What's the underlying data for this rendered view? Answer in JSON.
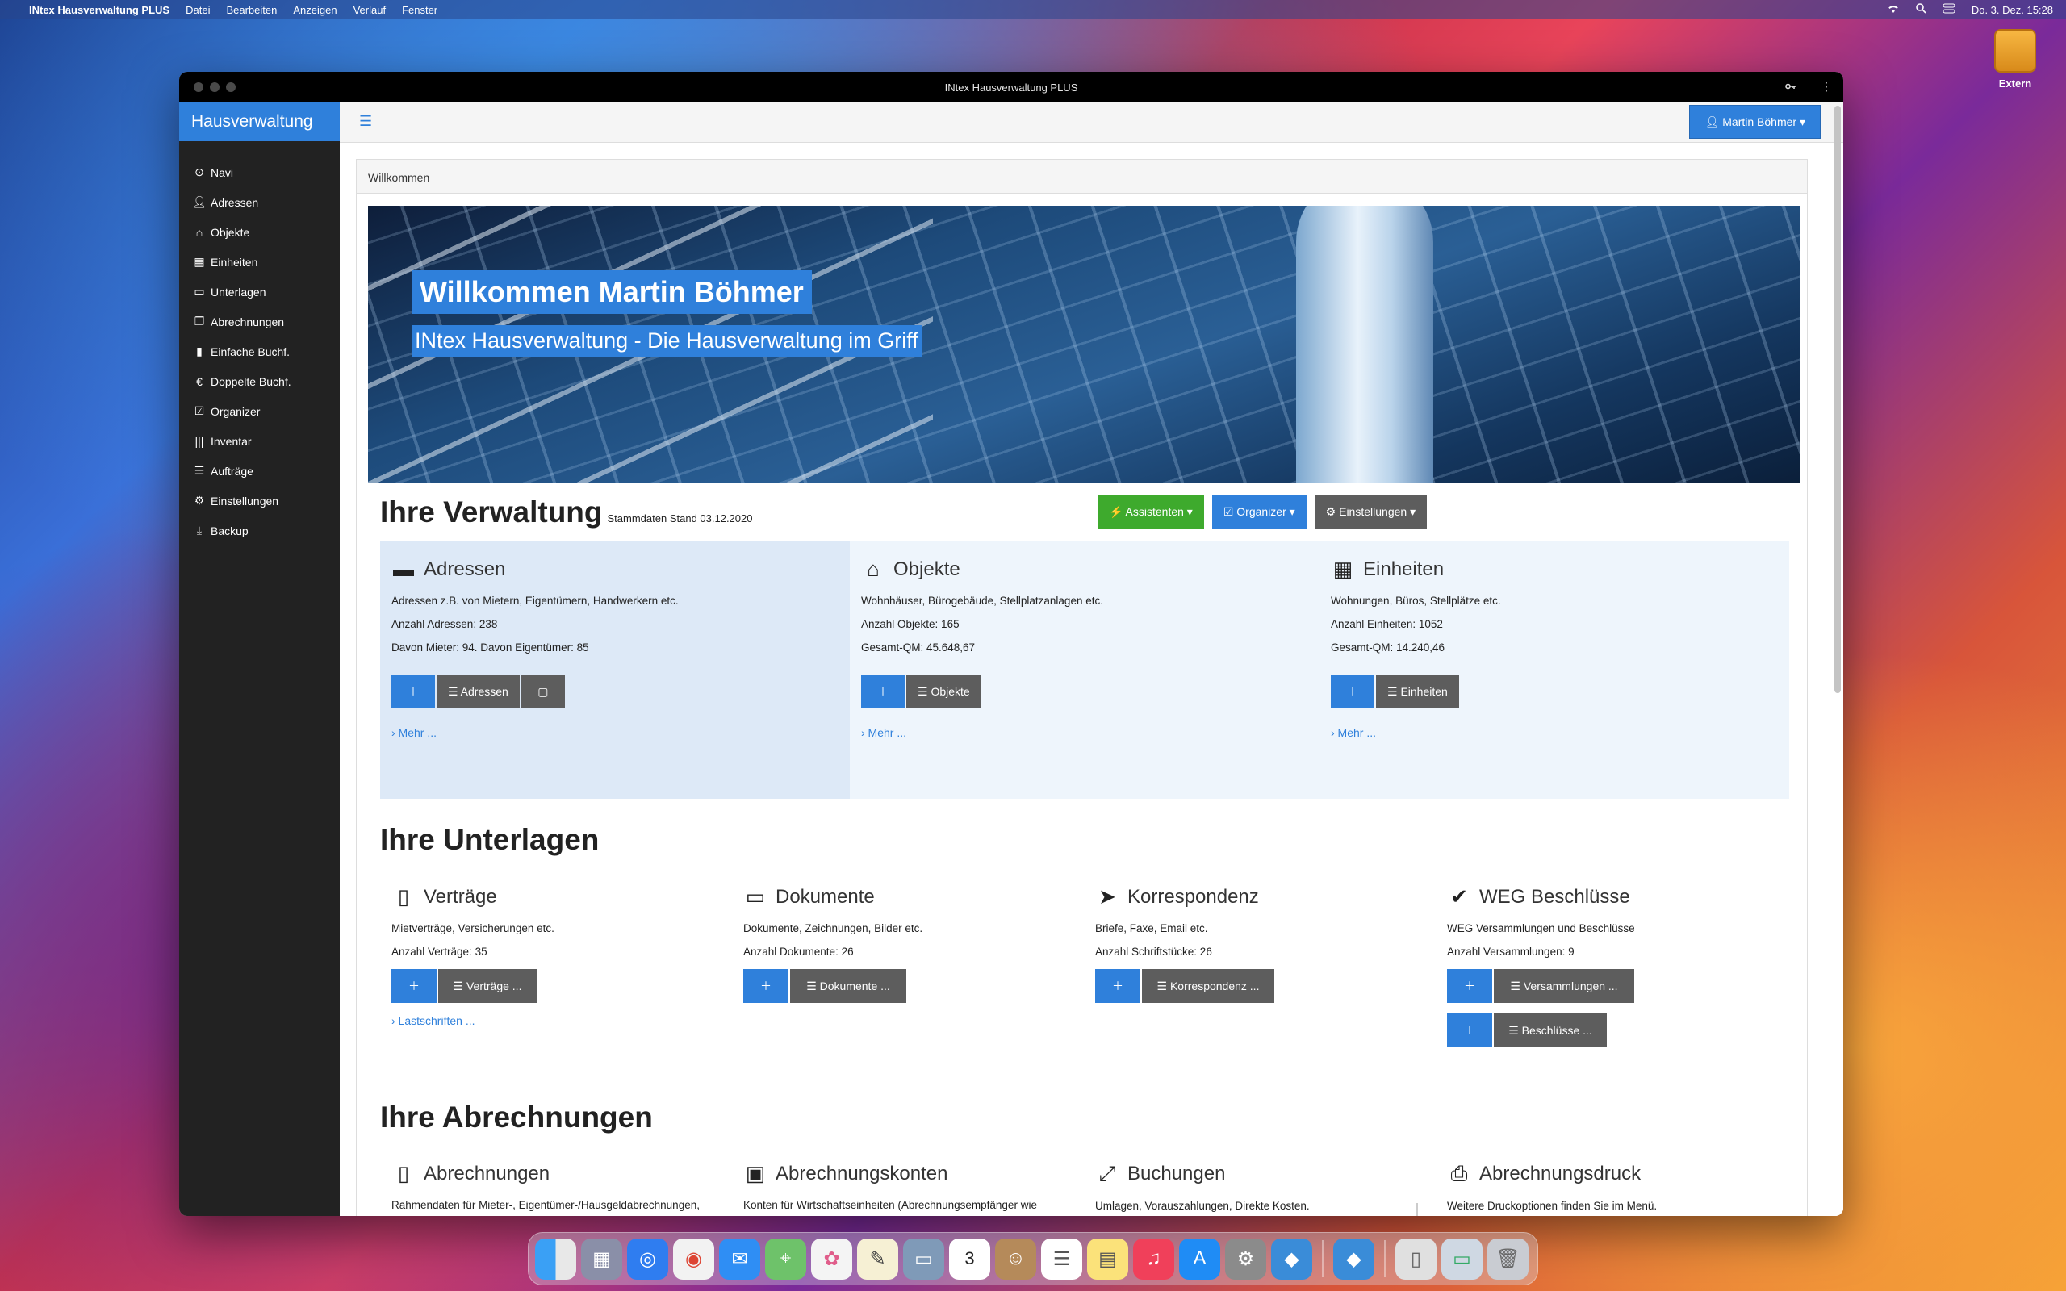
{
  "menubar": {
    "app_name": "INtex Hausverwaltung PLUS",
    "items": [
      "Datei",
      "Bearbeiten",
      "Anzeigen",
      "Verlauf",
      "Fenster"
    ],
    "datetime": "Do. 3. Dez.  15:28"
  },
  "desktop": {
    "drive_label": "Extern"
  },
  "window": {
    "title": "INtex Hausverwaltung PLUS"
  },
  "sidebar": {
    "brand": "Hausverwaltung",
    "items": [
      {
        "label": "Navi",
        "icon": "compass-icon"
      },
      {
        "label": "Adressen",
        "icon": "user-icon"
      },
      {
        "label": "Objekte",
        "icon": "home-icon"
      },
      {
        "label": "Einheiten",
        "icon": "grid-icon"
      },
      {
        "label": "Unterlagen",
        "icon": "folder-icon"
      },
      {
        "label": "Abrechnungen",
        "icon": "files-icon"
      },
      {
        "label": "Einfache Buchf.",
        "icon": "book-icon"
      },
      {
        "label": "Doppelte Buchf.",
        "icon": "euro-icon"
      },
      {
        "label": "Organizer",
        "icon": "check-square-icon"
      },
      {
        "label": "Inventar",
        "icon": "barcode-icon"
      },
      {
        "label": "Aufträge",
        "icon": "list-icon"
      },
      {
        "label": "Einstellungen",
        "icon": "gear-icon"
      },
      {
        "label": "Backup",
        "icon": "download-icon"
      }
    ]
  },
  "topbar": {
    "user": "Martin Böhmer ▾"
  },
  "panel": {
    "heading": "Willkommen"
  },
  "hero": {
    "title": "Willkommen Martin Böhmer",
    "subtitle": "INtex Hausverwaltung - Die Hausverwaltung im Griff"
  },
  "verwaltung": {
    "title": "Ihre Verwaltung",
    "subtitle": "Stammdaten Stand 03.12.2020",
    "buttons": {
      "assistenten": "⚡ Assistenten ▾",
      "organizer": "☑ Organizer ▾",
      "einstellungen": "⚙ Einstellungen ▾"
    },
    "cards": [
      {
        "title": "Adressen",
        "desc": "Adressen z.B. von Mietern, Eigentümern, Handwerkern etc.",
        "line1": "Anzahl Adressen: 238",
        "line2": "Davon Mieter: 94. Davon Eigentümer: 85",
        "list_btn": "☰ Adressen",
        "more": "›  Mehr ..."
      },
      {
        "title": "Objekte",
        "desc": "Wohnhäuser, Bürogebäude, Stellplatzanlagen etc.",
        "line1": "Anzahl Objekte: 165",
        "line2": "Gesamt-QM: 45.648,67",
        "list_btn": "☰ Objekte",
        "more": "›  Mehr ..."
      },
      {
        "title": "Einheiten",
        "desc": "Wohnungen, Büros, Stellplätze etc.",
        "line1": "Anzahl Einheiten: 1052",
        "line2": "Gesamt-QM: 14.240,46",
        "list_btn": "☰ Einheiten",
        "more": "›  Mehr ..."
      }
    ]
  },
  "unterlagen": {
    "title": "Ihre Unterlagen",
    "cards": [
      {
        "title": "Verträge",
        "desc": "Mietverträge, Versicherungen etc.",
        "count": "Anzahl Verträge: 35",
        "list_btn": "☰ Verträge ...",
        "more": "›  Lastschriften ..."
      },
      {
        "title": "Dokumente",
        "desc": "Dokumente, Zeichnungen, Bilder etc.",
        "count": "Anzahl Dokumente: 26",
        "list_btn": "☰ Dokumente ..."
      },
      {
        "title": "Korrespondenz",
        "desc": "Briefe, Faxe, Email etc.",
        "count": "Anzahl Schriftstücke: 26",
        "list_btn": "☰ Korrespondenz ..."
      },
      {
        "title": "WEG Beschlüsse",
        "desc": "WEG Versammlungen und Beschlüsse",
        "count": "Anzahl Versammlungen: 9",
        "list_btn": "☰ Versammlungen ...",
        "list_btn2": "☰ Beschlüsse ..."
      }
    ]
  },
  "abrechnungen": {
    "title": "Ihre Abrechnungen",
    "cards": [
      {
        "title": "Abrechnungen",
        "desc": "Rahmendaten für Mieter-, Eigentümer-/Hausgeldabrechnungen,"
      },
      {
        "title": "Abrechnungskonten",
        "desc": "Konten für Wirtschaftseinheiten (Abrechnungsempfänger wie"
      },
      {
        "title": "Buchungen",
        "desc": "Umlagen, Vorauszahlungen, Direkte Kosten."
      },
      {
        "title": "Abrechnungsdruck",
        "desc": "Weitere Druckoptionen finden Sie im Menü."
      }
    ]
  },
  "colors": {
    "accent": "#2f80db",
    "sidebar": "#222222",
    "green": "#3eaa2d",
    "gray": "#5d5d5d"
  }
}
